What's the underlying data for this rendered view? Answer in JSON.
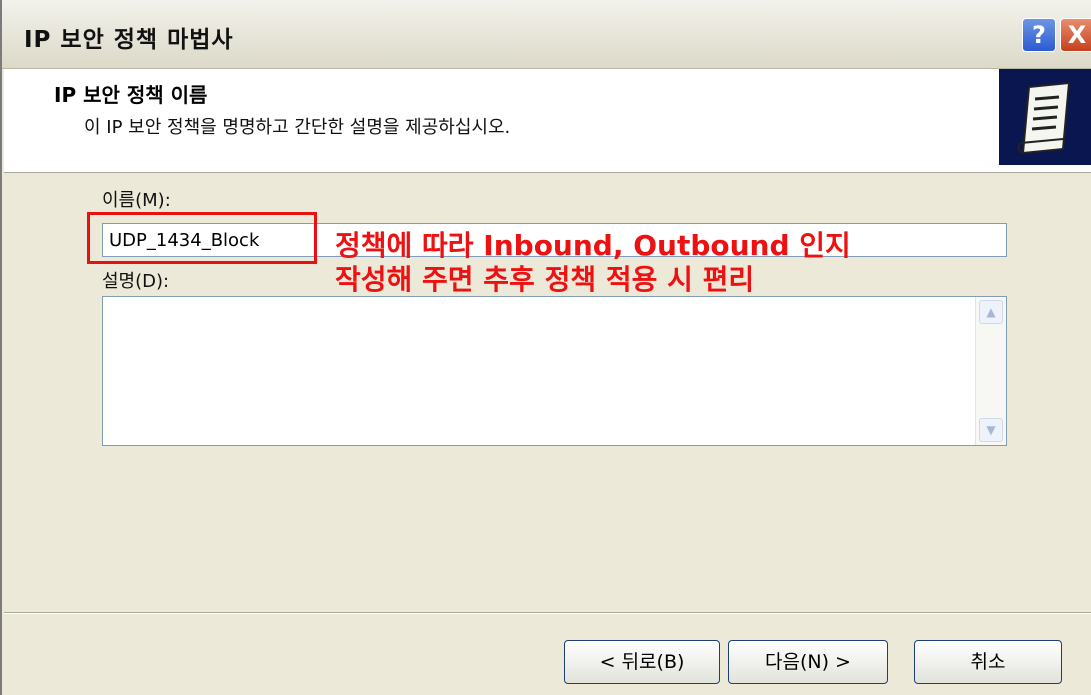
{
  "window": {
    "title": "IP 보안 정책 마법사",
    "help_label": "?",
    "close_label": "X"
  },
  "header": {
    "title": "IP 보안 정책 이름",
    "subtitle": "이 IP 보안 정책을 명명하고 간단한 설명을 제공하십시오."
  },
  "form": {
    "name_label": "이름(M):",
    "name_value": "UDP_1434_Block",
    "description_label": "설명(D):",
    "description_value": ""
  },
  "annotation": {
    "line1": "정책에 따라 Inbound, Outbound 인지",
    "line2": "작성해 주면 추후 정책 적용 시 편리",
    "color": "#ee1111"
  },
  "buttons": {
    "back": "< 뒤로(B)",
    "next": "다음(N) >",
    "cancel": "취소"
  }
}
